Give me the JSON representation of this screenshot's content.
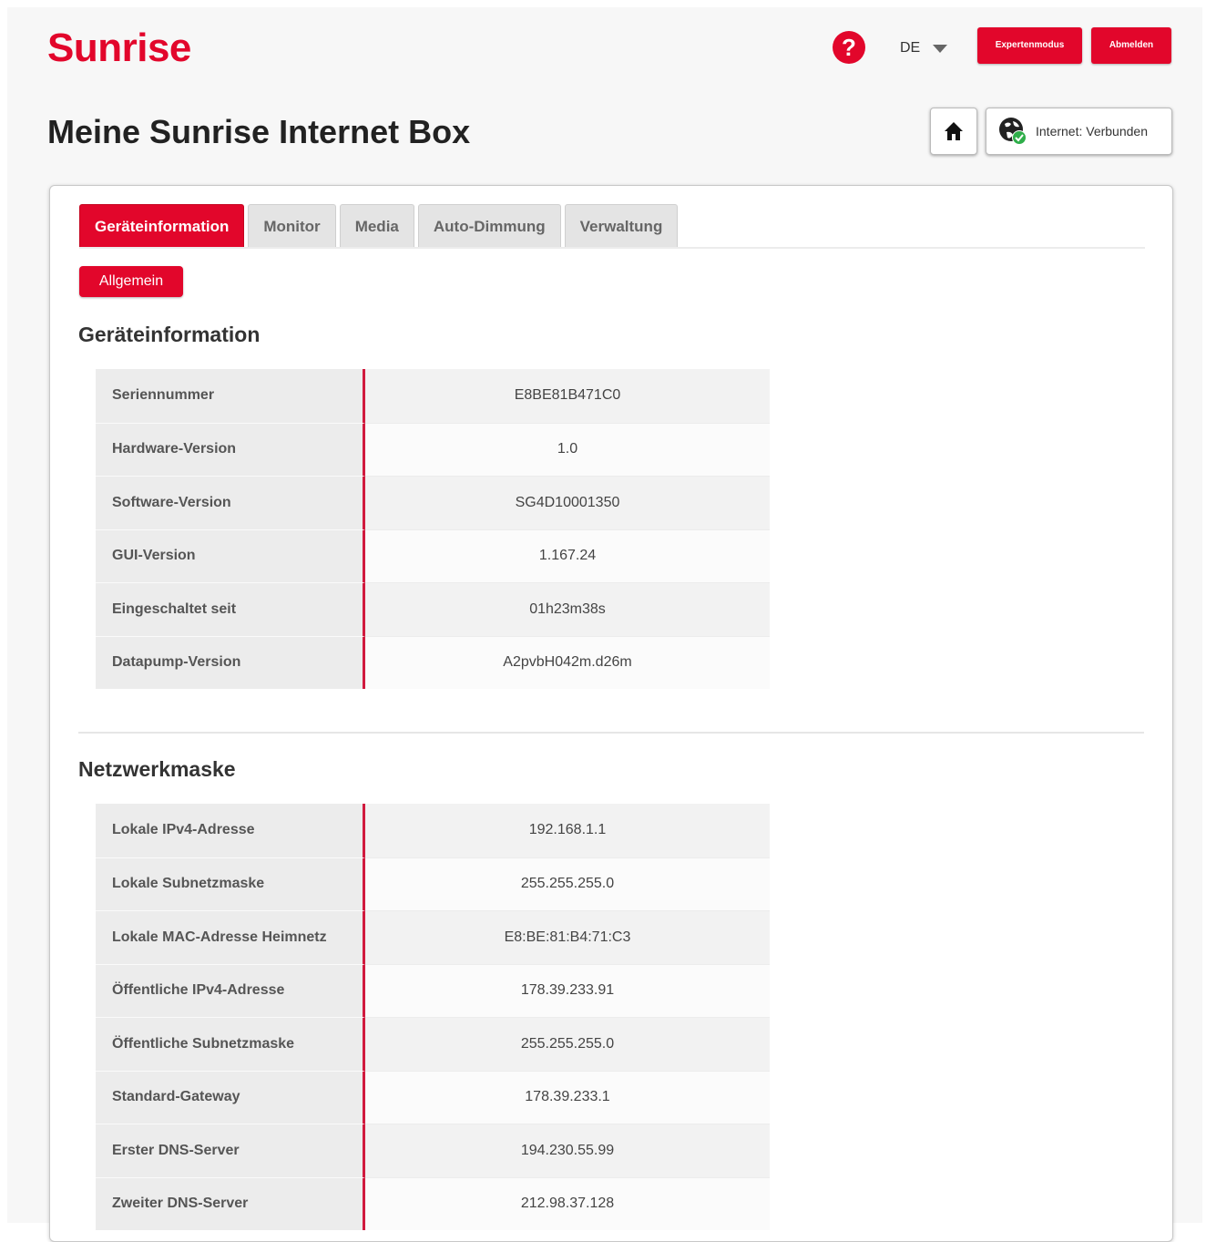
{
  "brand": {
    "logo_text": "Sunrise",
    "accent_color": "#e2062b"
  },
  "header": {
    "language": "DE",
    "expert_mode_label": "Expertenmodus",
    "logout_label": "Abmelden",
    "help_icon": "question-circle-icon"
  },
  "page": {
    "title": "Meine Sunrise Internet Box",
    "home_icon": "home-icon",
    "internet_status": "Internet: Verbunden"
  },
  "tabs": [
    {
      "label": "Geräteinformation",
      "active": true
    },
    {
      "label": "Monitor",
      "active": false
    },
    {
      "label": "Media",
      "active": false
    },
    {
      "label": "Auto-Dimmung",
      "active": false
    },
    {
      "label": "Verwaltung",
      "active": false
    }
  ],
  "subtabs": [
    {
      "label": "Allgemein",
      "active": true
    }
  ],
  "device_info": {
    "title": "Geräteinformation",
    "rows": [
      {
        "label": "Seriennummer",
        "value": "E8BE81B471C0"
      },
      {
        "label": "Hardware-Version",
        "value": "1.0"
      },
      {
        "label": "Software-Version",
        "value": "SG4D10001350"
      },
      {
        "label": "GUI-Version",
        "value": "1.167.24"
      },
      {
        "label": "Eingeschaltet seit",
        "value": "01h23m38s"
      },
      {
        "label": "Datapump-Version",
        "value": "A2pvbH042m.d26m"
      }
    ]
  },
  "network": {
    "title": "Netzwerkmaske",
    "rows": [
      {
        "label": "Lokale IPv4-Adresse",
        "value": "192.168.1.1"
      },
      {
        "label": "Lokale Subnetzmaske",
        "value": "255.255.255.0"
      },
      {
        "label": "Lokale MAC-Adresse Heimnetz",
        "value": "E8:BE:81:B4:71:C3"
      },
      {
        "label": "Öffentliche IPv4-Adresse",
        "value": "178.39.233.91"
      },
      {
        "label": "Öffentliche Subnetzmaske",
        "value": "255.255.255.0"
      },
      {
        "label": "Standard-Gateway",
        "value": "178.39.233.1"
      },
      {
        "label": "Erster DNS-Server",
        "value": "194.230.55.99"
      },
      {
        "label": "Zweiter DNS-Server",
        "value": "212.98.37.128"
      }
    ]
  }
}
